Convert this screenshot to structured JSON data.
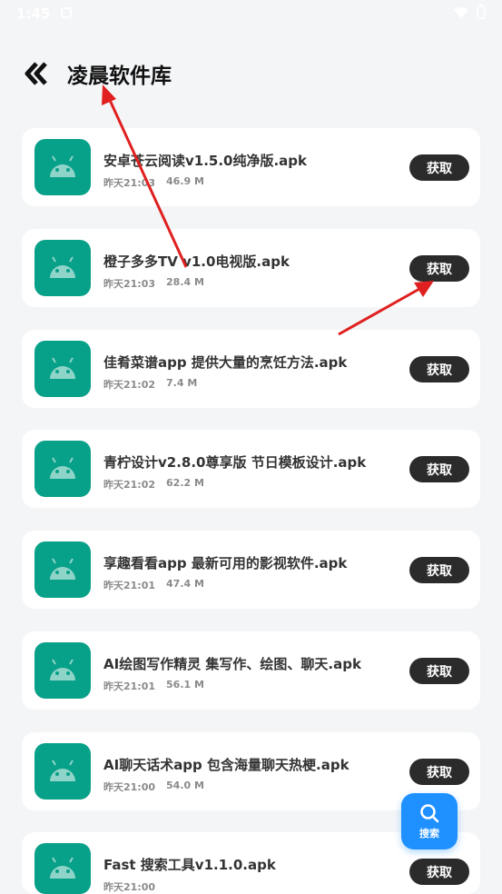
{
  "status_bar": {
    "time": "1:45"
  },
  "header": {
    "title": "凌晨软件库"
  },
  "apps": [
    {
      "name": "安卓苍云阅读v1.5.0纯净版.apk",
      "time": "昨天21:03",
      "size": "46.9 M",
      "button": "获取"
    },
    {
      "name": "橙子多多TV v1.0电视版.apk",
      "time": "昨天21:03",
      "size": "28.4 M",
      "button": "获取"
    },
    {
      "name": "佳肴菜谱app 提供大量的烹饪方法.apk",
      "time": "昨天21:02",
      "size": "7.4 M",
      "button": "获取"
    },
    {
      "name": "青柠设计v2.8.0尊享版 节日模板设计.apk",
      "time": "昨天21:02",
      "size": "62.2 M",
      "button": "获取"
    },
    {
      "name": "享趣看看app 最新可用的影视软件.apk",
      "time": "昨天21:01",
      "size": "47.4 M",
      "button": "获取"
    },
    {
      "name": "AI绘图写作精灵 集写作、绘图、聊天.apk",
      "time": "昨天21:01",
      "size": "56.1 M",
      "button": "获取"
    },
    {
      "name": "AI聊天话术app 包含海量聊天热梗.apk",
      "time": "昨天21:00",
      "size": "54.0 M",
      "button": "获取"
    },
    {
      "name": "Fast 搜索工具v1.1.0.apk",
      "time": "昨天21:00",
      "size": "",
      "button": "获取"
    }
  ],
  "fab": {
    "label": "搜索"
  },
  "colors": {
    "accent": "#1e90ff",
    "app_icon_bg": "#07a088",
    "button_bg": "#2b2b2b",
    "annotation_arrow": "#e02020"
  }
}
